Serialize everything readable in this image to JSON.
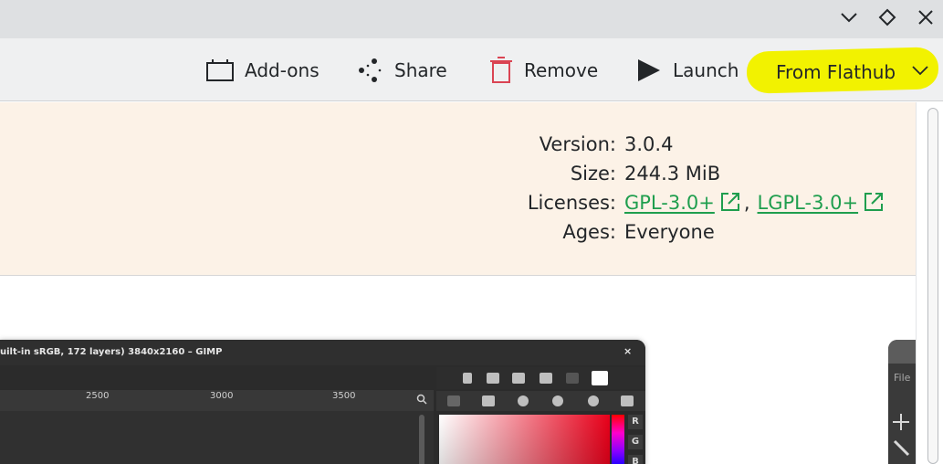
{
  "window": {
    "minimize_icon": "chevron-down-icon",
    "maximize_icon": "diamond-icon",
    "close_icon": "close-icon"
  },
  "toolbar": {
    "addons_label": "Add-ons",
    "share_label": "Share",
    "remove_label": "Remove",
    "launch_label": "Launch",
    "source_selected": "From Flathub",
    "highlight_color": "#f2f200"
  },
  "info": {
    "version_key": "Version:",
    "version_value": "3.0.4",
    "size_key": "Size:",
    "size_value": "244.3 MiB",
    "licenses_key": "Licenses:",
    "licenses": [
      "GPL-3.0+",
      "LGPL-3.0+"
    ],
    "license_separator": ",",
    "ages_key": "Ages:",
    "ages_value": "Everyone",
    "link_color": "#1f9e4e",
    "background": "#fcf2e7"
  },
  "screenshot": {
    "title": "uilt-in sRGB, 172 layers) 3840x2160 – GIMP",
    "close": "×",
    "ruler_labels": [
      "2500",
      "3000",
      "3500"
    ],
    "channels": [
      "R",
      "G",
      "B"
    ]
  },
  "screenshot2": {
    "menu_label": "File"
  }
}
